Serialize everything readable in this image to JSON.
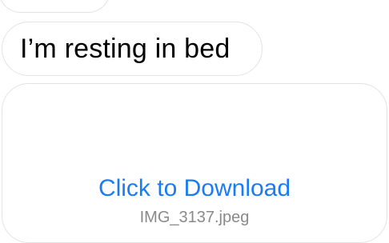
{
  "messages": [
    {
      "text": "I’m resting in bed"
    }
  ],
  "attachment": {
    "action_label": "Click to Download",
    "file_name": "IMG_3137.jpeg"
  },
  "colors": {
    "link_blue": "#1a7cf5",
    "bubble_border": "#e3e3e3",
    "filename_gray": "#8a8a8a",
    "text_black": "#000000"
  }
}
